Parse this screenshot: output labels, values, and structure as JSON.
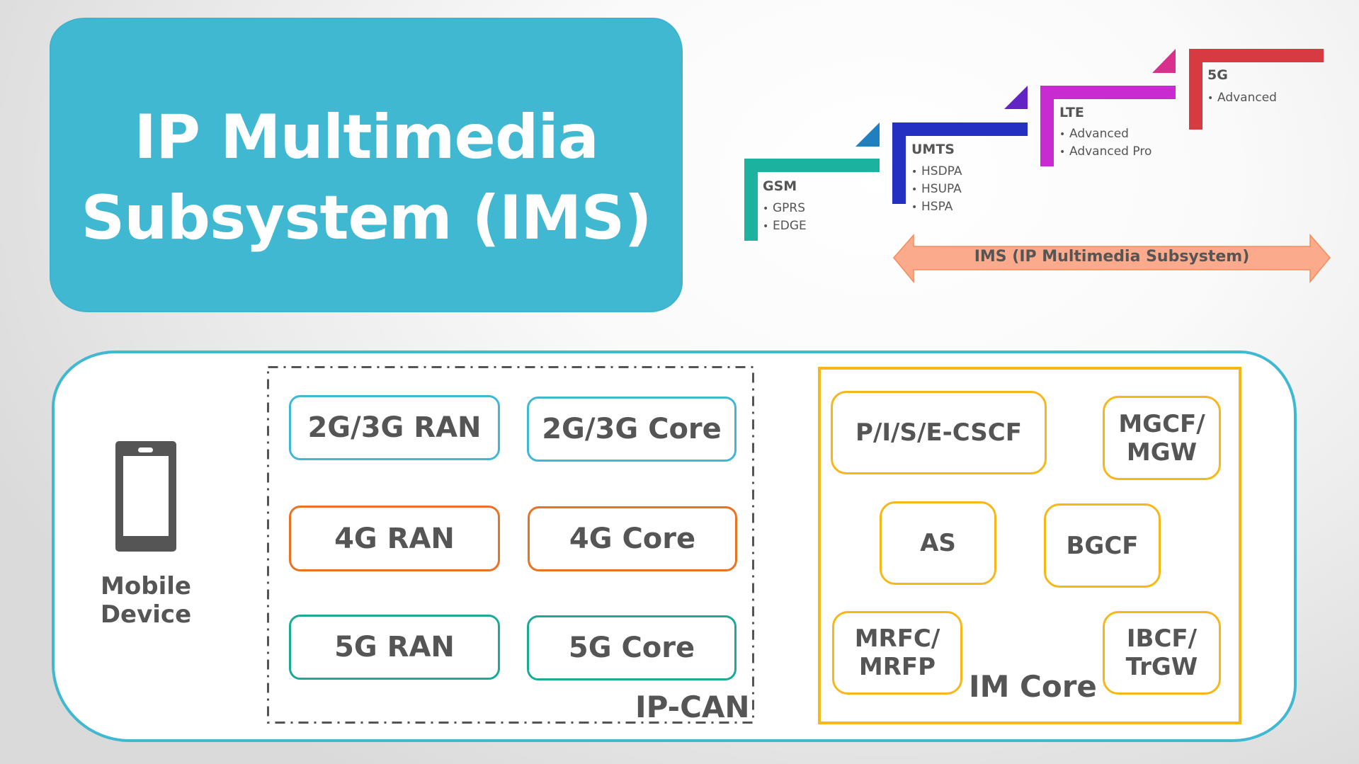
{
  "title": {
    "line1": "IP Multimedia",
    "line2": "Subsystem (IMS)"
  },
  "colors": {
    "title_bg": "#41b8d2",
    "panel_border": "#41b8d2",
    "gen_2g3g": "#41b8d2",
    "gen_4g": "#ec7121",
    "gen_5g": "#1aaa96",
    "ims_node": "#f6b819",
    "text": "#555555",
    "arrow_fill": "#fcaa8c",
    "arrow_stroke": "#f28c5b"
  },
  "timeline": {
    "generations": [
      {
        "id": "gsm",
        "title": "GSM",
        "items": [
          "GPRS",
          "EDGE"
        ],
        "bar_color": "#1bb3a0",
        "triangle_color": "#1f7fbf"
      },
      {
        "id": "umts",
        "title": "UMTS",
        "items": [
          "HSDPA",
          "HSUPA",
          "HSPA"
        ],
        "bar_color": "#2330c2",
        "triangle_color": "#6324c4"
      },
      {
        "id": "lte",
        "title": "LTE",
        "items": [
          "Advanced",
          "Advanced Pro"
        ],
        "bar_color": "#c82cd0",
        "triangle_color": "#d8308c"
      },
      {
        "id": "5g",
        "title": "5G",
        "items": [
          "Advanced"
        ],
        "bar_color": "#d73a40"
      }
    ],
    "ims_arrow_label": "IMS (IP Multimedia Subsystem)"
  },
  "device": {
    "icon": "mobile-phone-icon",
    "label_line1": "Mobile",
    "label_line2": "Device"
  },
  "ip_can": {
    "label": "IP-CAN",
    "nodes": [
      {
        "label": "2G/3G RAN",
        "gen": "2g3g"
      },
      {
        "label": "2G/3G Core",
        "gen": "2g3g"
      },
      {
        "label": "4G RAN",
        "gen": "4g"
      },
      {
        "label": "4G Core",
        "gen": "4g"
      },
      {
        "label": "5G RAN",
        "gen": "5g"
      },
      {
        "label": "5G Core",
        "gen": "5g"
      }
    ]
  },
  "im_core": {
    "label": "IM Core",
    "nodes": [
      {
        "line1": "P/I/S/E-CSCF",
        "line2": ""
      },
      {
        "line1": "MGCF/",
        "line2": "MGW"
      },
      {
        "line1": "AS",
        "line2": ""
      },
      {
        "line1": "BGCF",
        "line2": ""
      },
      {
        "line1": "MRFC/",
        "line2": "MRFP"
      },
      {
        "line1": "IBCF/",
        "line2": "TrGW"
      }
    ]
  }
}
